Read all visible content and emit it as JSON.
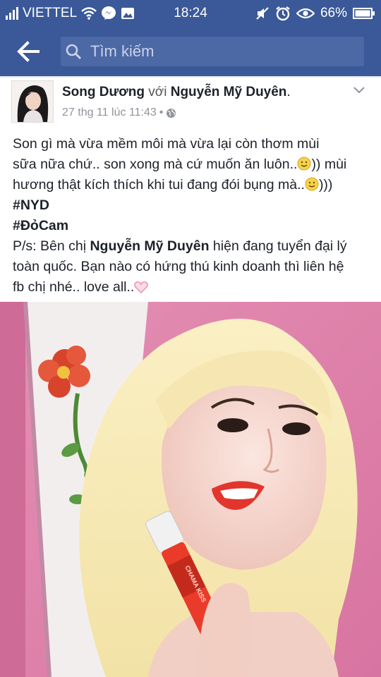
{
  "status_bar": {
    "carrier": "VIETTEL",
    "time": "18:24",
    "battery": "66%",
    "icons": [
      "signal-icon",
      "wifi-icon",
      "messenger-icon",
      "image-icon",
      "mute-icon",
      "alarm-icon",
      "eye-icon",
      "battery-icon"
    ]
  },
  "navbar": {
    "search_placeholder": "Tìm kiếm"
  },
  "post": {
    "author": "Song Dương",
    "with_word": "với",
    "tagged": "Nguyễn Mỹ Duyên",
    "author_suffix": ".",
    "timestamp": "27 thg 11 lúc 11:43",
    "meta_sep": "•",
    "line1": "Son gì mà vừa mềm môi mà vừa lại còn thơm mùi",
    "line2": "sữa nữa chứ.. son xong mà cứ muốn ăn luôn..",
    "line2_end": ")) mùi",
    "line3": "hương thật kích thích khi tui đang đói bụng mà..",
    "line3_end": ")))",
    "hashtag1": "#NYD",
    "hashtag2": "#ĐỏCam",
    "ps_prefix": "P/s: Bên chị ",
    "ps_name": "Nguyễn Mỹ Duyên",
    "ps_rest": " hiện đang tuyển đại lý",
    "line_ps2": "toàn quốc. Bạn nào có hứng thú kinh doanh thì liên hệ",
    "line_ps3": "fb chị nhé.. love all..",
    "product_label": "CHAMA KISS"
  },
  "colors": {
    "header_blue": "#3b5998",
    "search_bg": "#4c68a5",
    "text_dark": "#1d2129",
    "meta_gray": "#90949c"
  }
}
